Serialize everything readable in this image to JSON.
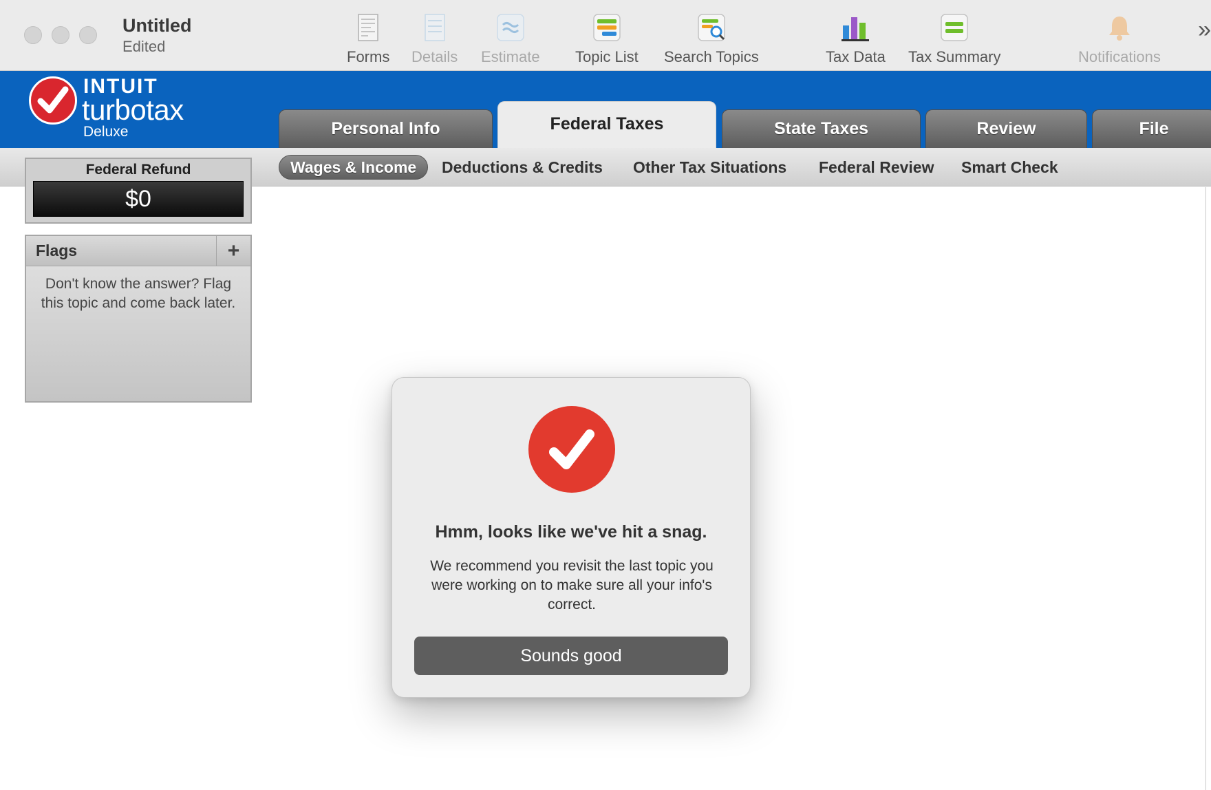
{
  "window": {
    "title": "Untitled",
    "subtitle": "Edited"
  },
  "toolbar": {
    "items": [
      {
        "label": "Forms",
        "icon": "forms-icon",
        "enabled": true
      },
      {
        "label": "Details",
        "icon": "details-icon",
        "enabled": false
      },
      {
        "label": "Estimate",
        "icon": "estimate-icon",
        "enabled": false
      },
      {
        "label": "Topic List",
        "icon": "topic-list-icon",
        "enabled": true
      },
      {
        "label": "Search Topics",
        "icon": "search-topics-icon",
        "enabled": true
      },
      {
        "label": "Tax Data",
        "icon": "bar-chart-icon",
        "enabled": true
      },
      {
        "label": "Tax Summary",
        "icon": "tax-summary-icon",
        "enabled": true
      },
      {
        "label": "Notifications",
        "icon": "bell-icon",
        "enabled": false
      }
    ],
    "overflow": "»"
  },
  "brand": {
    "intuit": "INTUIT",
    "product": "turbotax",
    "edition": "Deluxe"
  },
  "tabs": [
    {
      "label": "Personal Info",
      "active": false
    },
    {
      "label": "Federal Taxes",
      "active": true
    },
    {
      "label": "State Taxes",
      "active": false
    },
    {
      "label": "Review",
      "active": false
    },
    {
      "label": "File",
      "active": false
    }
  ],
  "subnav": [
    {
      "label": "Wages & Income",
      "active": true
    },
    {
      "label": "Deductions & Credits",
      "active": false
    },
    {
      "label": "Other Tax Situations",
      "active": false
    },
    {
      "label": "Federal Review",
      "active": false
    },
    {
      "label": "Smart Check",
      "active": false
    }
  ],
  "refund": {
    "label": "Federal Refund",
    "amount": "$0"
  },
  "flags": {
    "title": "Flags",
    "add": "+",
    "hint": "Don't know the answer? Flag this topic and come back later."
  },
  "dialog": {
    "title": "Hmm, looks like we've hit a snag.",
    "message": "We recommend you revisit the last topic you were working on to make sure all your info's correct.",
    "button": "Sounds good"
  },
  "colors": {
    "header_blue": "#0a63be",
    "brand_red": "#d9262e",
    "dialog_red": "#e23a2e",
    "button_gray": "#5e5e5e"
  }
}
